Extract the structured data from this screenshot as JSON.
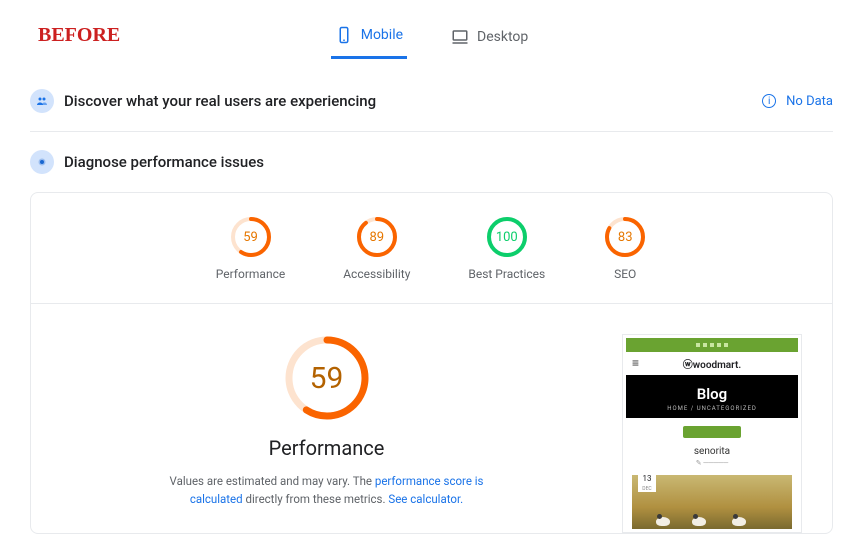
{
  "annotation": {
    "before": "BEFORE"
  },
  "tabs": {
    "mobile": "Mobile",
    "desktop": "Desktop"
  },
  "discover": {
    "title": "Discover what your real users are experiencing",
    "nodata": "No Data"
  },
  "diagnose": {
    "title": "Diagnose performance issues"
  },
  "gauges": {
    "performance": {
      "score": "59",
      "label": "Performance",
      "percent": 59,
      "status": "orange"
    },
    "accessibility": {
      "score": "89",
      "label": "Accessibility",
      "percent": 89,
      "status": "orange"
    },
    "best": {
      "score": "100",
      "label": "Best Practices",
      "percent": 100,
      "status": "green"
    },
    "seo": {
      "score": "83",
      "label": "SEO",
      "percent": 83,
      "status": "orange"
    }
  },
  "detail": {
    "score": "59",
    "percent": 59,
    "title": "Performance",
    "note_a": "Values are estimated and may vary. The ",
    "note_link1": "performance score is calculated",
    "note_b": " directly from these metrics. ",
    "note_link2": "See calculator."
  },
  "preview": {
    "brand": "ⓦwoodmart.",
    "blog": "Blog",
    "crumb": "HOME / UNCATEGORIZED",
    "caption": "senorita",
    "date_day": "13",
    "date_mon": "DEC"
  },
  "chart_data": [
    {
      "type": "gauge",
      "label": "Performance",
      "value": 59,
      "max": 100,
      "color": "#fa6400"
    },
    {
      "type": "gauge",
      "label": "Accessibility",
      "value": 89,
      "max": 100,
      "color": "#fa6400"
    },
    {
      "type": "gauge",
      "label": "Best Practices",
      "value": 100,
      "max": 100,
      "color": "#0cce6b"
    },
    {
      "type": "gauge",
      "label": "SEO",
      "value": 83,
      "max": 100,
      "color": "#fa6400"
    },
    {
      "type": "gauge",
      "label": "Performance (large)",
      "value": 59,
      "max": 100,
      "color": "#fa6400"
    }
  ]
}
